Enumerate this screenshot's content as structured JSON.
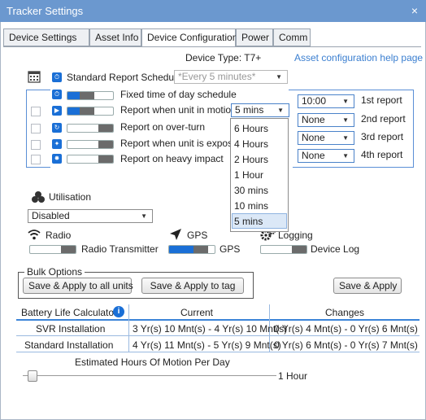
{
  "window": {
    "title": "Tracker Settings",
    "close_glyph": "×"
  },
  "tabs": [
    {
      "label": "Device Settings",
      "active": false
    },
    {
      "label": "Asset Info",
      "active": false
    },
    {
      "label": "Device Configuration",
      "active": true
    },
    {
      "label": "Power",
      "active": false
    },
    {
      "label": "Comm",
      "active": false
    }
  ],
  "device_type": "Device Type: T7+",
  "help_link": "Asset configuration help page",
  "standard_report": {
    "label": "Standard Report Schedule",
    "select_value": "*Every 5 minutes*"
  },
  "schedule_rows": [
    {
      "label": "Fixed time of day schedule",
      "icon": "clock-icon",
      "toggle": 0.4
    },
    {
      "label": "Report when unit in motion",
      "icon": "motion-icon",
      "toggle": 0.4,
      "select_value": "5 mins"
    },
    {
      "label": "Report on over-turn",
      "icon": "overturn-icon",
      "toggle": 0.0
    },
    {
      "label": "Report when unit is exposed",
      "icon": "light-bulb-icon",
      "toggle": 0.0
    },
    {
      "label": "Report on heavy impact",
      "icon": "impact-icon",
      "toggle": 0.0
    }
  ],
  "motion_dropdown_options": [
    "6 Hours",
    "4 Hours",
    "2 Hours",
    "1 Hour",
    "30 mins",
    "10 mins",
    "5 mins"
  ],
  "motion_dropdown_selected": "5 mins",
  "reports": [
    {
      "value": "10:00",
      "label": "1st report"
    },
    {
      "value": "None",
      "label": "2nd report"
    },
    {
      "value": "None",
      "label": "3rd report"
    },
    {
      "value": "None",
      "label": "4th report"
    }
  ],
  "utilisation": {
    "label": "Utilisation",
    "select_value": "Disabled"
  },
  "modules": [
    {
      "label": "Radio",
      "sub_label": "Radio Transmitter",
      "icon": "wifi-icon",
      "toggle": 0.0
    },
    {
      "label": "GPS",
      "sub_label": "GPS",
      "icon": "location-arrow-icon",
      "toggle": 0.8
    },
    {
      "label": "Logging",
      "sub_label": "Device Log",
      "icon": "gears-icon",
      "toggle": 0.0
    }
  ],
  "bulk_options": {
    "legend": "Bulk Options",
    "apply_all": "Save & Apply to all units",
    "apply_tag": "Save & Apply to tag"
  },
  "save_apply": "Save & Apply",
  "battery_table": {
    "headers": [
      "Battery Life Calculator",
      "Current",
      "Changes"
    ],
    "info_glyph": "i",
    "rows": [
      [
        "SVR Installation",
        "3 Yr(s) 10 Mnt(s) - 4 Yr(s) 10 Mnt(s)",
        "0 Yr(s) 4 Mnt(s) - 0 Yr(s) 6 Mnt(s)"
      ],
      [
        "Standard Installation",
        "4 Yr(s) 11 Mnt(s) - 5 Yr(s) 9 Mnt(s)",
        "0 Yr(s) 6 Mnt(s) - 0 Yr(s) 7 Mnt(s)"
      ]
    ]
  },
  "motion_hours": {
    "label": "Estimated Hours Of Motion Per Day",
    "value_label": "1 Hour",
    "slider_fraction": 0.02
  },
  "colors": {
    "titlebar": "#6b98cf",
    "accent": "#1a6fd6",
    "link": "#3b7fd0",
    "table_line": "#3b84d8"
  }
}
